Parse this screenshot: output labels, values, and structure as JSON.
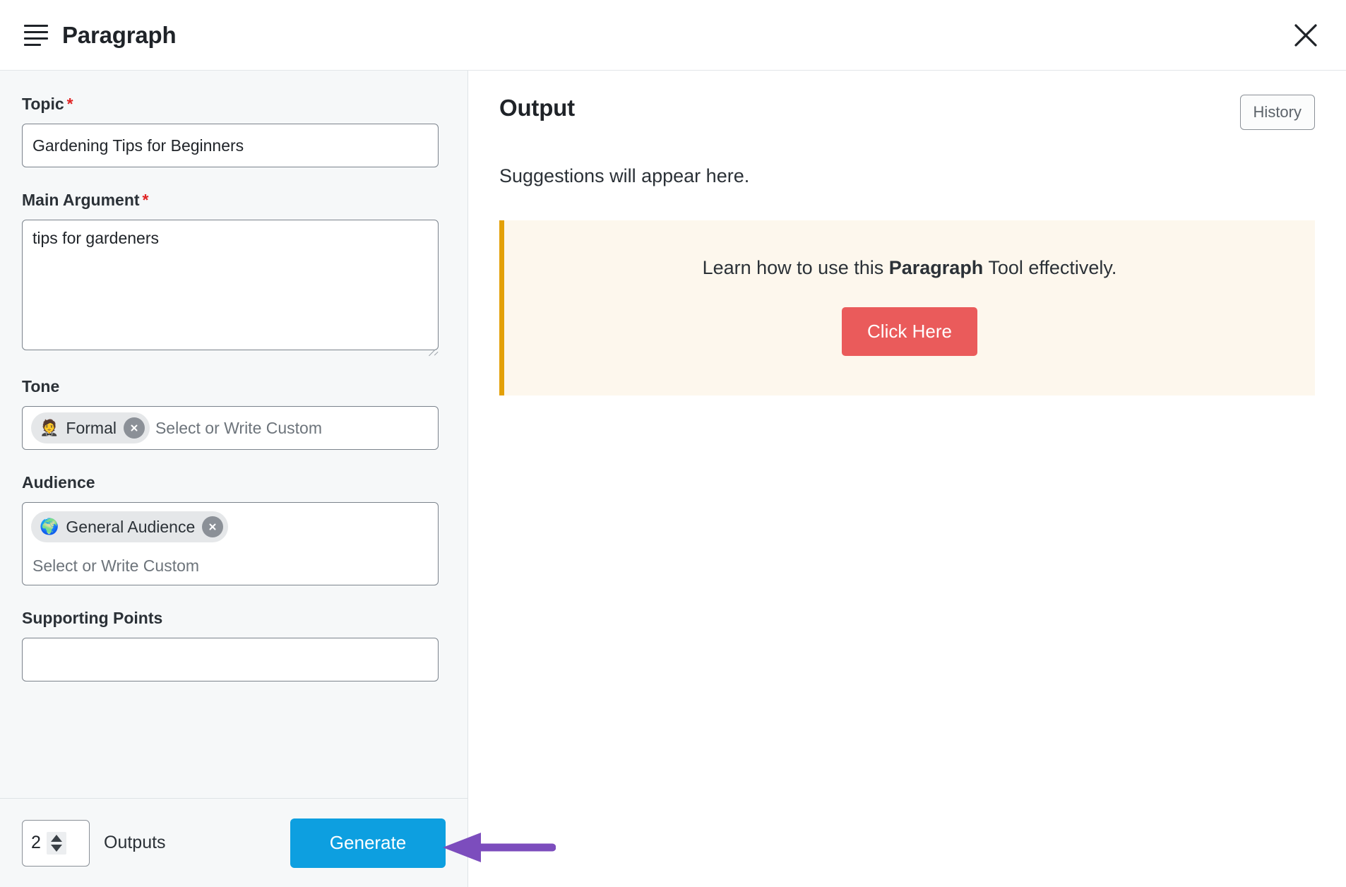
{
  "header": {
    "menu_icon": "paragraph-lines-icon",
    "title": "Paragraph",
    "close_icon": "close-icon"
  },
  "form": {
    "topic": {
      "label": "Topic",
      "required_marker": "*",
      "value": "Gardening Tips for Beginners"
    },
    "main_argument": {
      "label": "Main Argument",
      "required_marker": "*",
      "value": "tips for gardeners"
    },
    "tone": {
      "label": "Tone",
      "chips": [
        {
          "emoji": "🤵",
          "emoji_name": "person-in-tuxedo-emoji",
          "label": "Formal",
          "remove_icon": "close-circle-icon"
        }
      ],
      "placeholder": "Select or Write Custom"
    },
    "audience": {
      "label": "Audience",
      "chips": [
        {
          "emoji": "🌍",
          "emoji_name": "globe-earth-emoji",
          "label": "General Audience",
          "remove_icon": "close-circle-icon"
        }
      ],
      "placeholder": "Select or Write Custom"
    },
    "supporting_points": {
      "label": "Supporting Points",
      "placeholder": ""
    }
  },
  "bottom_bar": {
    "outputs_count": "2",
    "outputs_label": "Outputs",
    "generate_label": "Generate",
    "stepper_up_icon": "chevron-up-icon",
    "stepper_down_icon": "chevron-down-icon"
  },
  "output": {
    "title": "Output",
    "history_label": "History",
    "empty_text": "Suggestions will appear here.",
    "callout": {
      "text_before": "Learn how to use this ",
      "text_bold": "Paragraph",
      "text_after": " Tool effectively.",
      "button_label": "Click Here"
    }
  },
  "annotation": {
    "arrow_name": "arrow-pointing-to-generate",
    "color": "#7c4dbd"
  },
  "colors": {
    "accent_blue": "#0d9fe0",
    "callout_bg": "#fdf7ed",
    "callout_border": "#e3a008",
    "callout_button": "#ea5b5b",
    "required": "#e02424",
    "panel_bg": "#f6f8f9",
    "annotation_purple": "#7c4dbd"
  }
}
